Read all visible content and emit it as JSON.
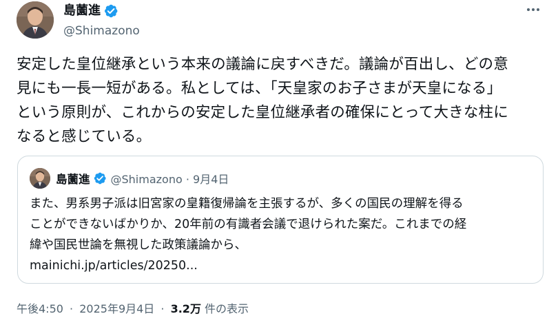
{
  "author": {
    "display_name": "島薗進",
    "handle": "@Shimazono",
    "verified_icon": "verified-badge-icon",
    "badge_color": "#1d9bf0"
  },
  "tweet": {
    "lines": [
      "安定した皇位継承という本来の議論に戻すべきだ。議論が百出し、どの意",
      "見にも一長一短がある。私としては、「天皇家のお子さまが天皇になる」",
      "という原則が、これからの安定した皇位継承者の確保にとって大きな柱に",
      "なると感じている。"
    ]
  },
  "quoted": {
    "display_name": "島薗進",
    "handle": "@Shimazono",
    "dot": "·",
    "date": "9月4日",
    "lines": [
      "また、男系男子派は旧宮家の皇籍復帰論を主張するが、多くの国民の理解を得る",
      "ことができないばかりか、20年前の有識者会議で退けられた案だ。これまでの経",
      "緯や国民世論を無視した政策議論から、"
    ],
    "link_text": "mainichi.jp/articles/20250..."
  },
  "footer": {
    "time": "午後4:50",
    "dot": "·",
    "date": "2025年9月4日",
    "views_count": "3.2万",
    "views_label": "件の表示"
  },
  "colors": {
    "text": "#0f1419",
    "secondary": "#536471",
    "border": "#cfd9de",
    "accent": "#1d9bf0"
  }
}
